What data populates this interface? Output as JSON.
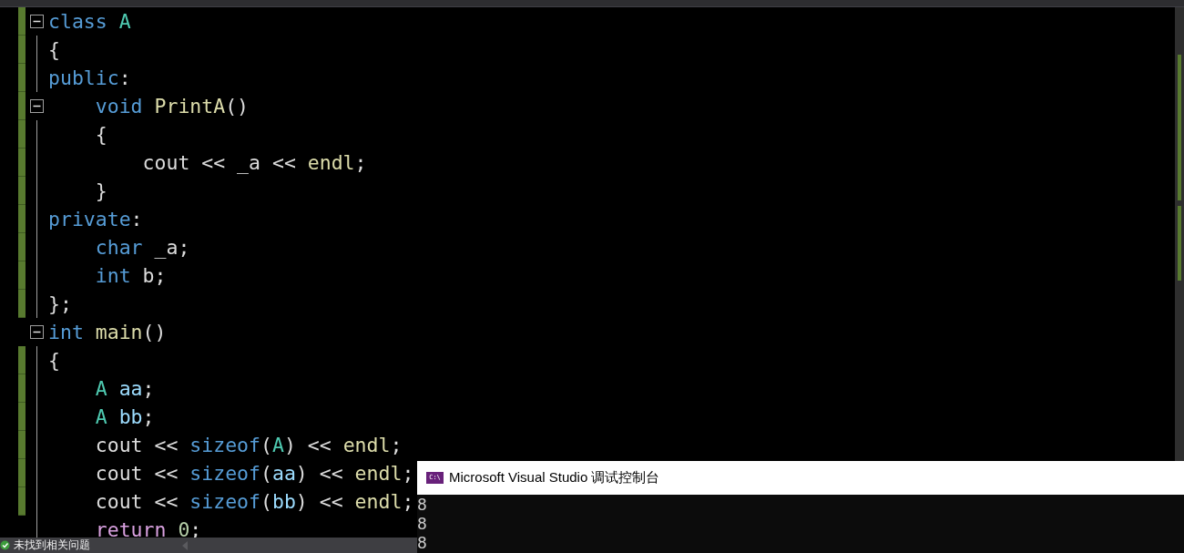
{
  "editor": {
    "lines": [
      {
        "changed": true,
        "collapsible": true,
        "tokens": [
          {
            "text": "class ",
            "kind": "keyword"
          },
          {
            "text": "A",
            "kind": "type"
          }
        ]
      },
      {
        "changed": true,
        "collapsible": false,
        "tokens": [
          {
            "text": "{",
            "kind": "plain"
          }
        ]
      },
      {
        "changed": true,
        "collapsible": false,
        "tokens": [
          {
            "text": "public",
            "kind": "keyword"
          },
          {
            "text": ":",
            "kind": "plain"
          }
        ]
      },
      {
        "changed": true,
        "collapsible": true,
        "tokens": [
          {
            "text": "    void ",
            "kind": "keyword"
          },
          {
            "text": "PrintA",
            "kind": "func"
          },
          {
            "text": "()",
            "kind": "plain"
          }
        ]
      },
      {
        "changed": true,
        "collapsible": false,
        "tokens": [
          {
            "text": "    {",
            "kind": "plain"
          }
        ]
      },
      {
        "changed": true,
        "collapsible": false,
        "tokens": [
          {
            "text": "        cout << _a << ",
            "kind": "plain"
          },
          {
            "text": "endl",
            "kind": "func"
          },
          {
            "text": ";",
            "kind": "plain"
          }
        ]
      },
      {
        "changed": true,
        "collapsible": false,
        "tokens": [
          {
            "text": "    }",
            "kind": "plain"
          }
        ]
      },
      {
        "changed": true,
        "collapsible": false,
        "tokens": [
          {
            "text": "private",
            "kind": "keyword"
          },
          {
            "text": ":",
            "kind": "plain"
          }
        ]
      },
      {
        "changed": true,
        "collapsible": false,
        "tokens": [
          {
            "text": "    char ",
            "kind": "keyword"
          },
          {
            "text": "_a;",
            "kind": "plain"
          }
        ]
      },
      {
        "changed": true,
        "collapsible": false,
        "tokens": [
          {
            "text": "    int ",
            "kind": "keyword"
          },
          {
            "text": "b;",
            "kind": "plain"
          }
        ]
      },
      {
        "changed": true,
        "collapsible": false,
        "tokens": [
          {
            "text": "};",
            "kind": "plain"
          }
        ]
      },
      {
        "changed": false,
        "collapsible": true,
        "tokens": [
          {
            "text": "int ",
            "kind": "keyword"
          },
          {
            "text": "main",
            "kind": "func"
          },
          {
            "text": "()",
            "kind": "plain"
          }
        ]
      },
      {
        "changed": true,
        "collapsible": false,
        "tokens": [
          {
            "text": "{",
            "kind": "plain"
          }
        ]
      },
      {
        "changed": true,
        "collapsible": false,
        "tokens": [
          {
            "text": "    A ",
            "kind": "type"
          },
          {
            "text": "aa",
            "kind": "var"
          },
          {
            "text": ";",
            "kind": "plain"
          }
        ]
      },
      {
        "changed": true,
        "collapsible": false,
        "tokens": [
          {
            "text": "    A ",
            "kind": "type"
          },
          {
            "text": "bb",
            "kind": "var"
          },
          {
            "text": ";",
            "kind": "plain"
          }
        ]
      },
      {
        "changed": true,
        "collapsible": false,
        "tokens": [
          {
            "text": "    cout << ",
            "kind": "plain"
          },
          {
            "text": "sizeof",
            "kind": "keyword"
          },
          {
            "text": "(",
            "kind": "plain"
          },
          {
            "text": "A",
            "kind": "type"
          },
          {
            "text": ") << ",
            "kind": "plain"
          },
          {
            "text": "endl",
            "kind": "func"
          },
          {
            "text": ";",
            "kind": "plain"
          }
        ]
      },
      {
        "changed": true,
        "collapsible": false,
        "tokens": [
          {
            "text": "    cout << ",
            "kind": "plain"
          },
          {
            "text": "sizeof",
            "kind": "keyword"
          },
          {
            "text": "(",
            "kind": "plain"
          },
          {
            "text": "aa",
            "kind": "var"
          },
          {
            "text": ") << ",
            "kind": "plain"
          },
          {
            "text": "endl",
            "kind": "func"
          },
          {
            "text": ";",
            "kind": "plain"
          }
        ]
      },
      {
        "changed": true,
        "collapsible": false,
        "tokens": [
          {
            "text": "    cout << ",
            "kind": "plain"
          },
          {
            "text": "sizeof",
            "kind": "keyword"
          },
          {
            "text": "(",
            "kind": "plain"
          },
          {
            "text": "bb",
            "kind": "var"
          },
          {
            "text": ") << ",
            "kind": "plain"
          },
          {
            "text": "endl",
            "kind": "func"
          },
          {
            "text": ";",
            "kind": "plain"
          }
        ]
      },
      {
        "changed": false,
        "collapsible": false,
        "tokens": [
          {
            "text": "    return ",
            "kind": "control"
          },
          {
            "text": "0",
            "kind": "number"
          },
          {
            "text": ";",
            "kind": "plain"
          }
        ]
      }
    ]
  },
  "status_bar": {
    "text": "未找到相关问题"
  },
  "console": {
    "title": "Microsoft Visual Studio 调试控制台",
    "icon": "C:\\",
    "output": [
      "8",
      "8",
      "8"
    ]
  }
}
